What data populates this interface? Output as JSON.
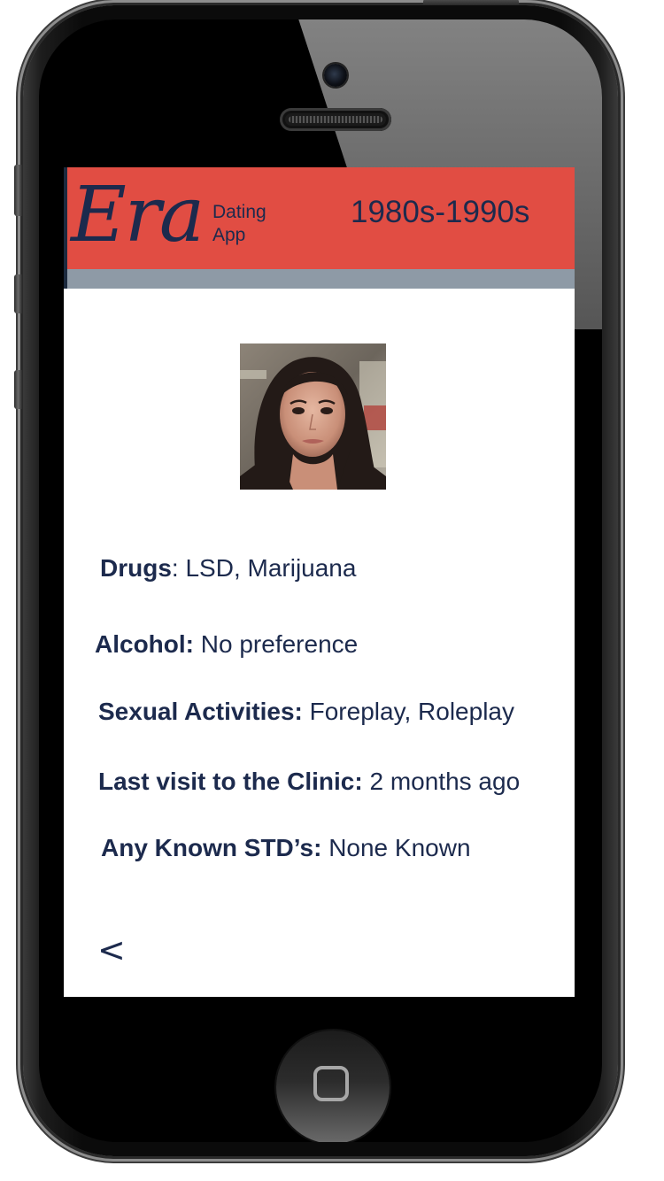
{
  "header": {
    "logo_text": "Era",
    "logo_sub_line1": "Dating",
    "logo_sub_line2": "App",
    "era_range": "1980s-1990s"
  },
  "profile": {
    "fields": [
      {
        "label": "Drugs",
        "separator": ": ",
        "value": "LSD, Marijuana"
      },
      {
        "label": "Alcohol:",
        "separator": " ",
        "value": "No preference"
      },
      {
        "label": "Sexual Activities:",
        "separator": " ",
        "value": "Foreplay, Roleplay"
      },
      {
        "label": "Last visit to the Clinic:",
        "separator": " ",
        "value": "2 months ago"
      },
      {
        "label": "Any Known STD’s:",
        "separator": " ",
        "value": "None Known"
      }
    ]
  },
  "navigation": {
    "back_label": "<"
  },
  "colors": {
    "header_bg": "#e14d43",
    "header_strip": "#8e9aa6",
    "text": "#1c2a4d",
    "screen_bg": "#ffffff"
  },
  "icons": {
    "back": "chevron-left-icon",
    "home": "home-button-icon"
  }
}
